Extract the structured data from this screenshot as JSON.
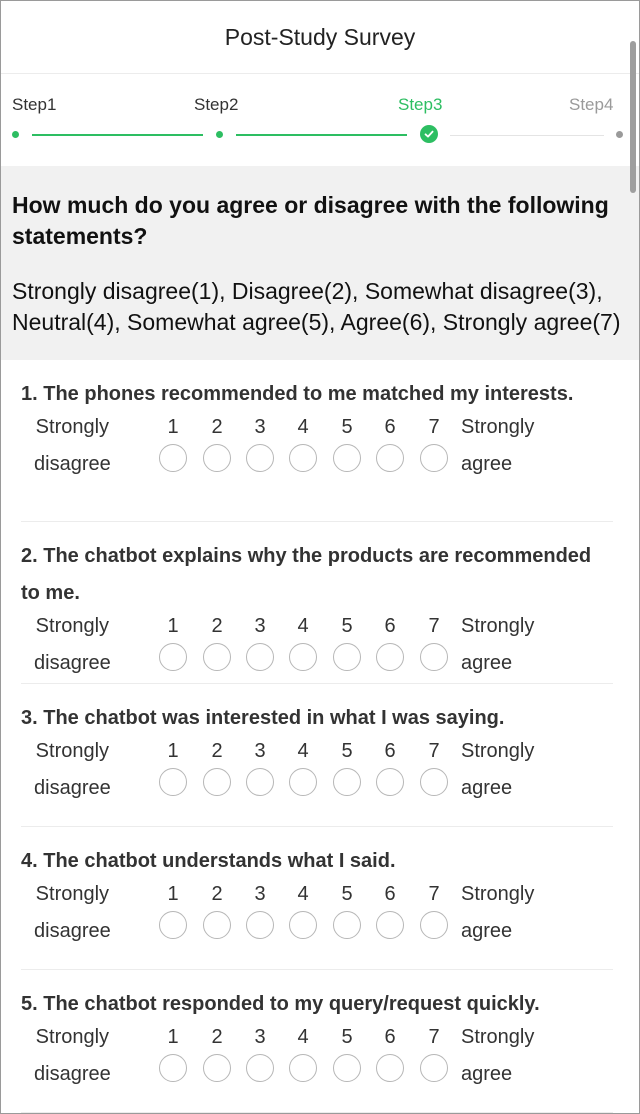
{
  "header": {
    "title": "Post-Study Survey"
  },
  "steps": [
    {
      "label": "Step1",
      "state": "done"
    },
    {
      "label": "Step2",
      "state": "done"
    },
    {
      "label": "Step3",
      "state": "current"
    },
    {
      "label": "Step4",
      "state": "pending"
    }
  ],
  "colors": {
    "accent": "#2dbe62",
    "inactive": "#9a9a9a"
  },
  "intro": {
    "heading": "How much do you agree or disagree with the following statements?",
    "scale_text": "Strongly disagree(1), Disagree(2), Somewhat disagree(3), Neutral(4), Somewhat agree(5), Agree(6), Strongly agree(7)"
  },
  "scale": {
    "left_label_1": "Strongly",
    "left_label_2": "disagree",
    "right_label_1": "Strongly",
    "right_label_2": "agree",
    "options": [
      "1",
      "2",
      "3",
      "4",
      "5",
      "6",
      "7"
    ]
  },
  "questions": [
    {
      "text": "1. The phones recommended to me matched my interests."
    },
    {
      "text": "2. The chatbot explains why the products are recommended to me."
    },
    {
      "text": "3. The chatbot was interested in what I was saying."
    },
    {
      "text": "4. The chatbot understands what I said."
    },
    {
      "text": "5. The chatbot responded to my query/request quickly."
    }
  ]
}
